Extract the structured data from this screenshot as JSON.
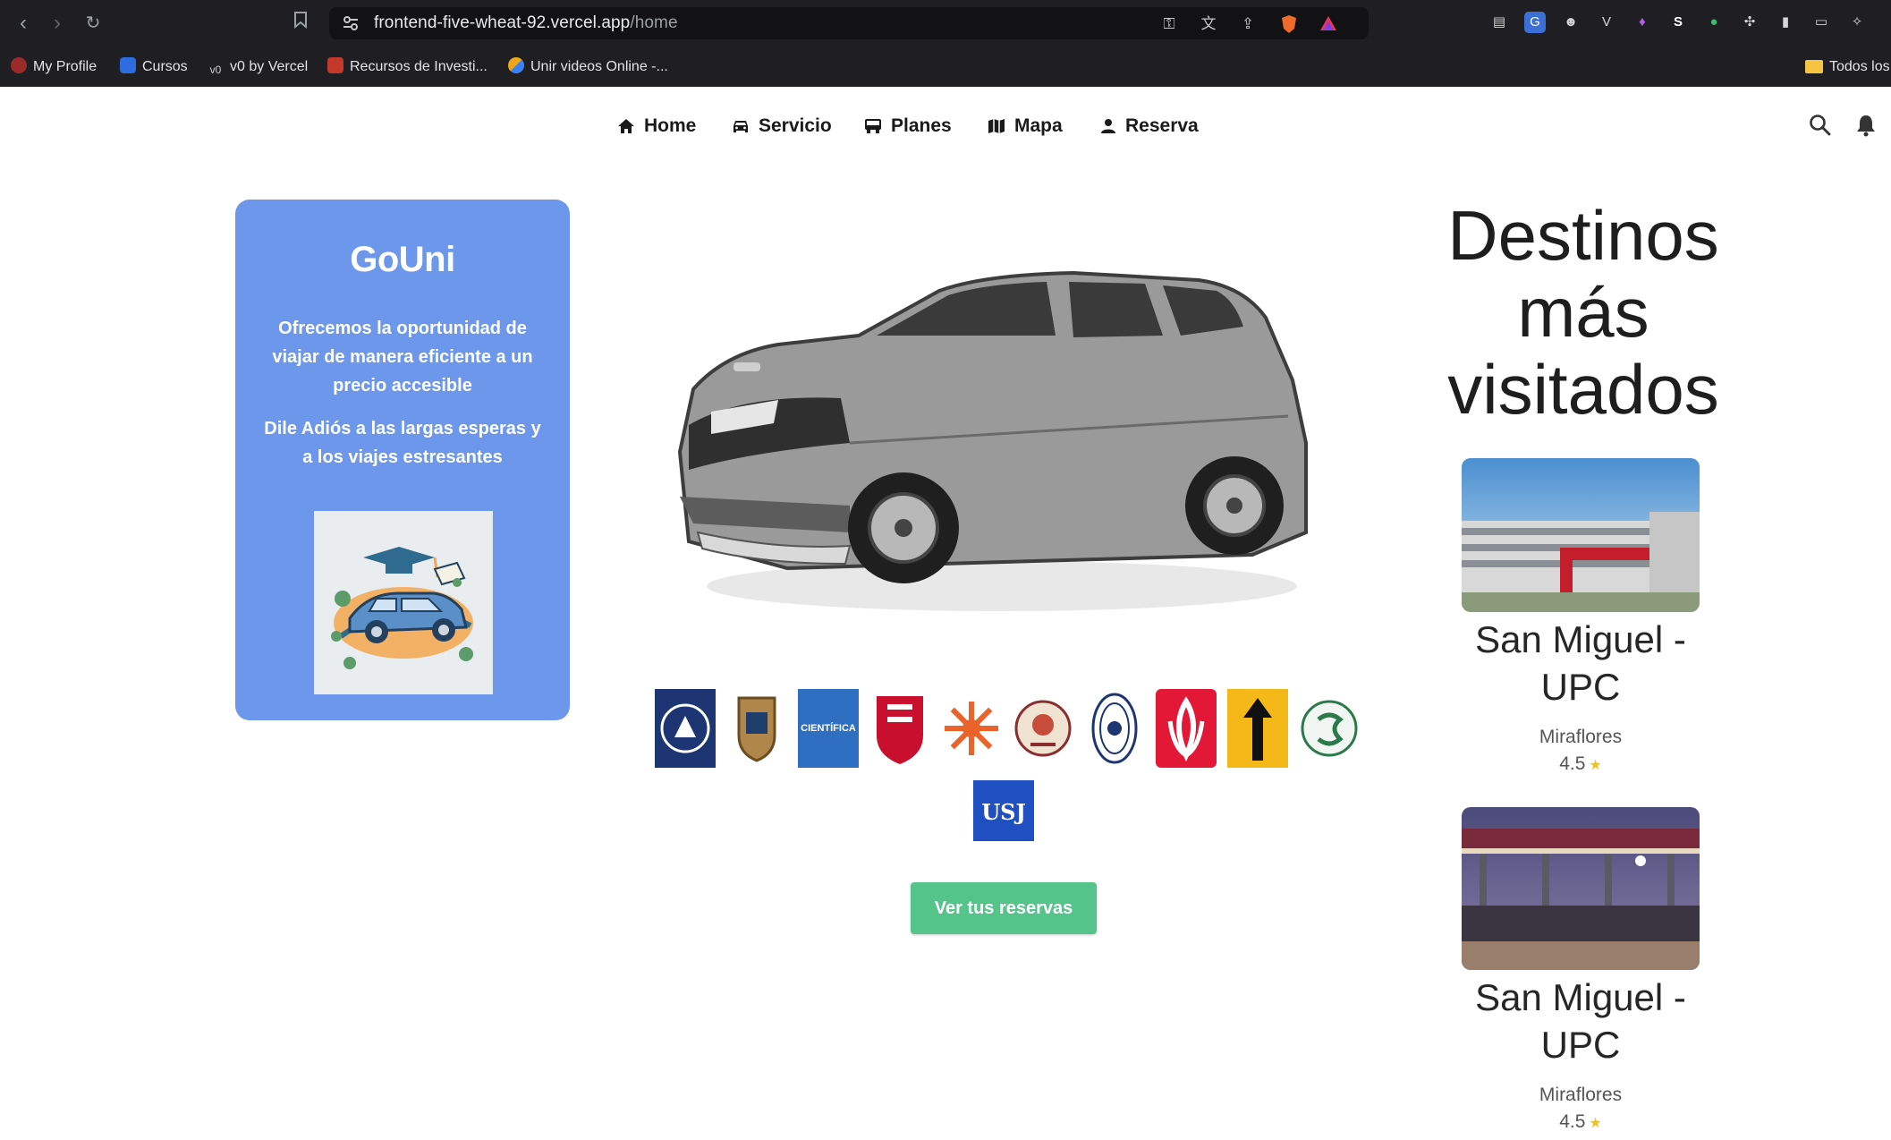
{
  "browser": {
    "url_host": "frontend-five-wheat-92.vercel.app",
    "url_path": "/home",
    "bookmarks": [
      {
        "label": "My Profile",
        "color": "#c0392b"
      },
      {
        "label": "Cursos",
        "color": "#2d6cdf"
      },
      {
        "label": "v0 by Vercel",
        "color": "#3aa66a"
      },
      {
        "label": "Recursos de Investi...",
        "color": "#c0392b"
      },
      {
        "label": "Unir videos Online -...",
        "color": "#f1a51a"
      }
    ],
    "bookmarks_folder": "Todos los"
  },
  "nav": {
    "items": [
      {
        "label": "Home",
        "icon": "home-icon"
      },
      {
        "label": "Servicio",
        "icon": "car-icon"
      },
      {
        "label": "Planes",
        "icon": "bus-icon"
      },
      {
        "label": "Mapa",
        "icon": "map-icon"
      },
      {
        "label": "Reserva",
        "icon": "user-icon"
      }
    ]
  },
  "card": {
    "title": "GoUni",
    "text1": "Ofrecemos la oportunidad de viajar de manera eficiente a un precio accesible",
    "text2": "Dile Adiós a las largas esperas y a los viajes estresantes",
    "bg_color": "#6d97ea"
  },
  "hero": {
    "cta_label": "Ver tus reservas",
    "cta_color": "#55c48a",
    "university_logo_label": "CIENTÍFICA"
  },
  "destinations": {
    "title": "Destinos más visitados",
    "items": [
      {
        "name": "San Miguel - UPC",
        "location": "Miraflores",
        "rating": "4.5"
      },
      {
        "name": "San Miguel - UPC",
        "location": "Miraflores",
        "rating": "4.5"
      }
    ]
  }
}
